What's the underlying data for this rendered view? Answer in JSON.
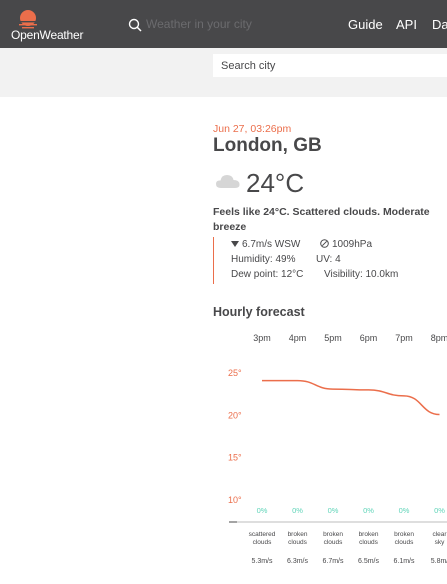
{
  "header": {
    "logo_text": "OpenWeather",
    "search_placeholder": "Weather in your city",
    "nav": [
      {
        "label": "Guide"
      },
      {
        "label": "API"
      },
      {
        "label": "Da"
      }
    ]
  },
  "city_search": {
    "placeholder": "Search city"
  },
  "current": {
    "date": "Jun 27, 03:26pm",
    "city": "London, GB",
    "temp": "24°C",
    "summary": "Feels like 24°C. Scattered clouds. Moderate breeze",
    "wind": "6.7m/s WSW",
    "pressure": "1009hPa",
    "humidity": "Humidity: 49%",
    "uv": "UV: 4",
    "dew_point": "Dew point: 12°C",
    "visibility": "Visibility: 10.0km"
  },
  "hourly": {
    "title": "Hourly forecast"
  },
  "chart_data": {
    "type": "line",
    "categories": [
      "3pm",
      "4pm",
      "5pm",
      "6pm",
      "7pm",
      "8pm"
    ],
    "series": [
      {
        "values": [
          24.1,
          24.1,
          23.1,
          23.0,
          22.3,
          20.1
        ]
      }
    ],
    "y_ticks": [
      "25°",
      "20°",
      "15°",
      "10°"
    ],
    "ylim": [
      10,
      25
    ],
    "precipitation": [
      "0%",
      "0%",
      "0%",
      "0%",
      "0%",
      "0%"
    ],
    "conditions": [
      [
        "scattered",
        "clouds"
      ],
      [
        "broken",
        "clouds"
      ],
      [
        "broken",
        "clouds"
      ],
      [
        "broken",
        "clouds"
      ],
      [
        "broken",
        "clouds"
      ],
      [
        "clear",
        "sky"
      ]
    ],
    "wind": [
      "5.3m/s",
      "6.3m/s",
      "6.7m/s",
      "6.5m/s",
      "6.1m/s",
      "5.8m/"
    ],
    "colors": {
      "line": "#eb6e4b",
      "precip": "#5ed4b8",
      "axis": "#48484a"
    }
  }
}
